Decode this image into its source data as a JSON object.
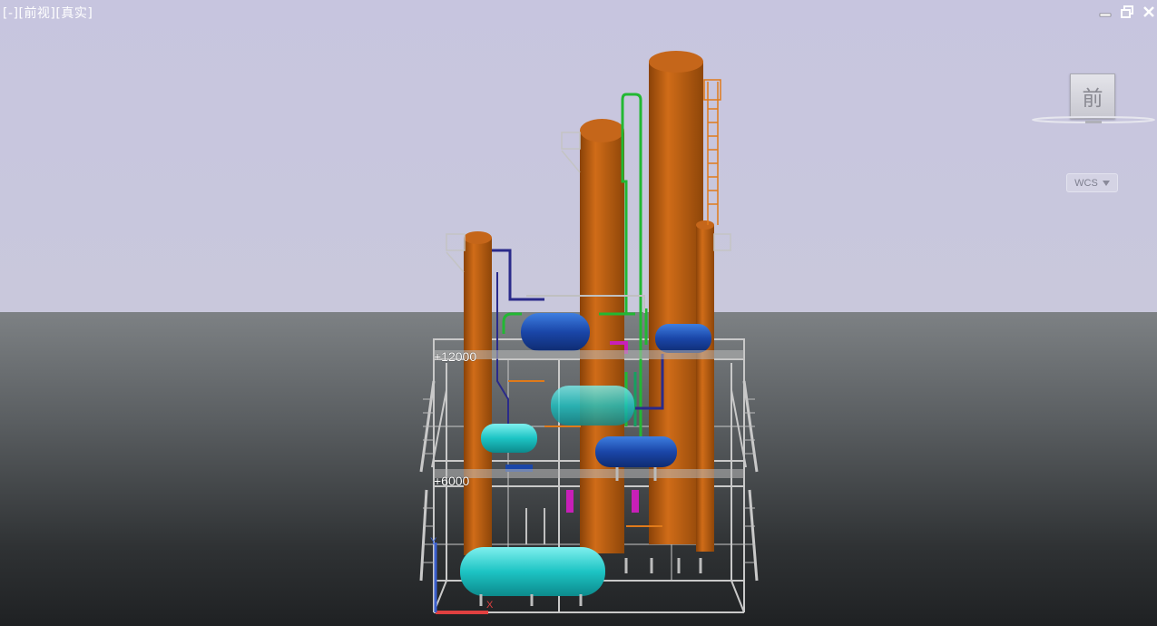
{
  "viewport": {
    "label": "[-][前视][真实]",
    "viewcube_face": "前",
    "coordinate_system": "WCS",
    "window_controls": [
      "minimize-icon",
      "restore-icon",
      "close-icon"
    ]
  },
  "scene": {
    "elevations": [
      "+12000",
      "+6000"
    ],
    "colors": {
      "column": "#b85a0c",
      "vessel_blue": "#1f4fb0",
      "vessel_cyan": "#1fc7c7",
      "pipe_green": "#22b833",
      "pipe_magenta": "#c81fb8",
      "pipe_navy": "#2a2a8a",
      "steel": "#c8c8c8",
      "ladder": "#e07a1a",
      "ucs_x": "#e04040",
      "ucs_y": "#3a5fd0"
    }
  }
}
